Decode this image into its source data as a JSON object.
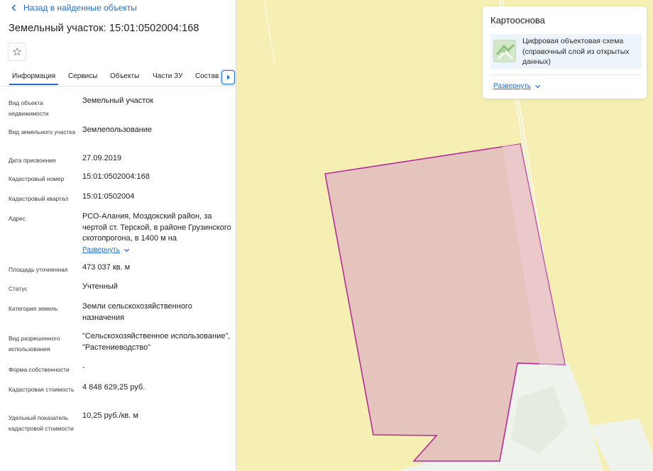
{
  "panel": {
    "back_label": "Назад в найденные объекты",
    "title": "Земельный участок: 15:01:0502004:168",
    "tabs": [
      "Информация",
      "Сервисы",
      "Объекты",
      "Части ЗУ",
      "Состав"
    ],
    "active_tab": "Информация",
    "rows": [
      {
        "label": "Вид объекта недвижимости",
        "value": "Земельный участок"
      },
      {
        "label": "Вид земельного участка",
        "value": "Землепользование"
      },
      {
        "label": "Дата присвоения",
        "value": "27.09.2019"
      },
      {
        "label": "Кадастровый номер",
        "value": "15:01:0502004:168"
      },
      {
        "label": "Кадастровый квартал",
        "value": "15:01:0502004"
      },
      {
        "label": "Адрес",
        "value": "РСО-Алания, Моздокский район, за чертой ст. Терской, в районе Грузинского скотопрогона, в 1400 м на"
      },
      {
        "label": "Площадь уточненная",
        "value": "473 037 кв. м"
      },
      {
        "label": "Статус",
        "value": "Учтенный"
      },
      {
        "label": "Категория земель",
        "value": "Земли сельскохозяйственного назначения"
      },
      {
        "label": "Вид разрешенного использования",
        "value": "\"Сельскохозяйственное использование\", \"Растениеводство\""
      },
      {
        "label": "Форма собственности",
        "value": "-"
      },
      {
        "label": "Кадастровая стоимость",
        "value": "4 848 629,25 руб."
      },
      {
        "label": "Удельный показатель кадастровой стоимости",
        "value": "10,25 руб./кв. м"
      }
    ],
    "address_expand_label": "Развернуть"
  },
  "card": {
    "title": "Картооснова",
    "layer_label": "Цифровая объектовая схема (справочный слой из открытых данных)",
    "expand_label": "Развернуть"
  },
  "icons": {
    "back": "chevron-left-icon",
    "favorite": "star-outline-icon",
    "tabs_next": "chevron-right-icon",
    "expand": "chevron-down-icon",
    "layer": "map-layer-thumbnail-icon"
  },
  "colors": {
    "accent": "#1f6fd6",
    "map_background": "#f6efb4",
    "parcel_fill": "#e6c4be",
    "parcel_stroke": "#b12d9c"
  }
}
